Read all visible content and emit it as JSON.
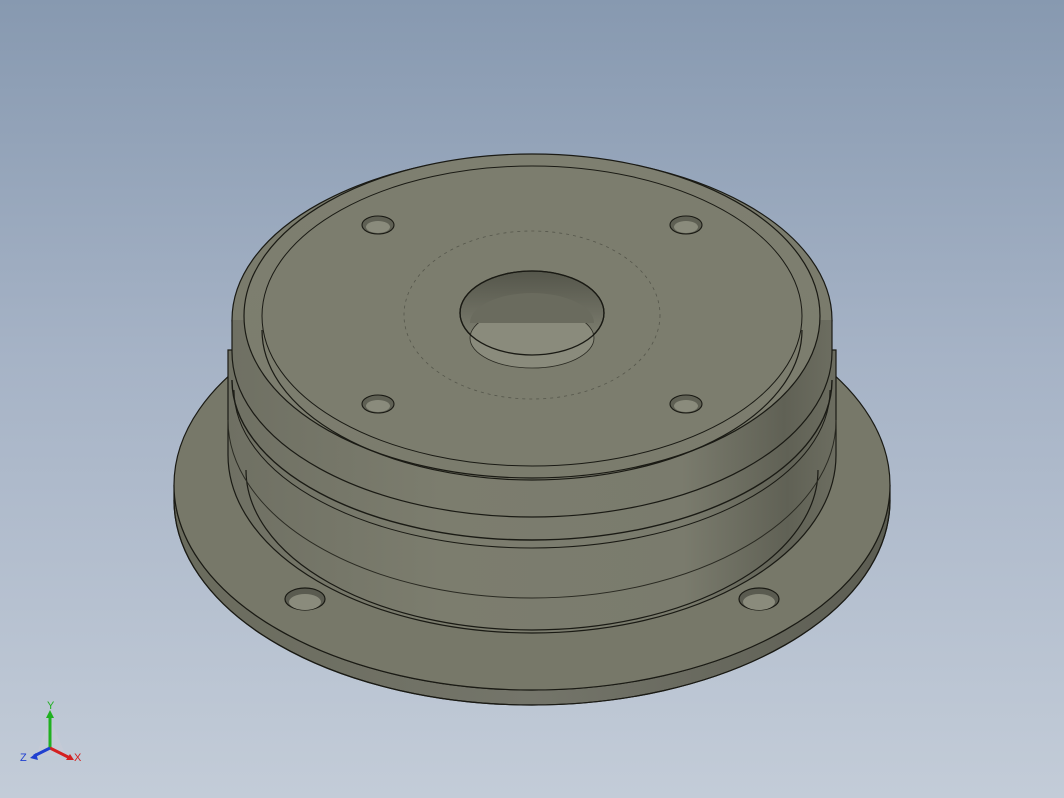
{
  "viewport": {
    "background_top": "#8799b0",
    "background_bottom": "#c3ccd8"
  },
  "model": {
    "description_icon": "flanged-housing-part",
    "body_color": "#7a7b6c",
    "edge_color": "#1a1a14"
  },
  "triad": {
    "x_label": "X",
    "y_label": "Y",
    "z_label": "Z",
    "x_color": "#d42020",
    "y_color": "#20b020",
    "z_color": "#2040d0"
  }
}
